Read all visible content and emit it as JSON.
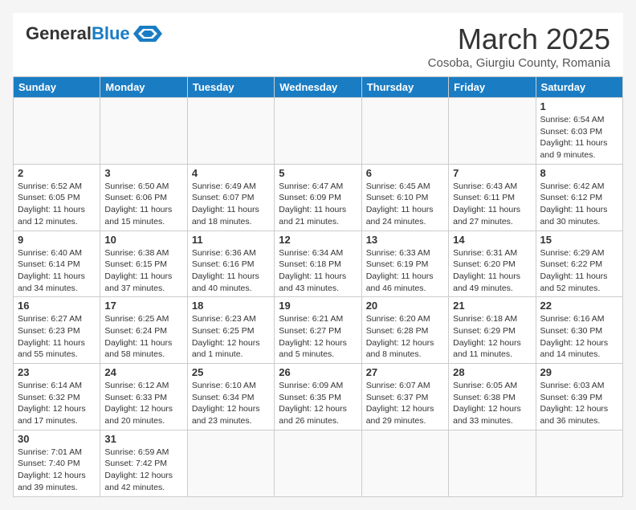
{
  "header": {
    "logo_general": "General",
    "logo_blue": "Blue",
    "month_title": "March 2025",
    "subtitle": "Cosoba, Giurgiu County, Romania"
  },
  "days_of_week": [
    "Sunday",
    "Monday",
    "Tuesday",
    "Wednesday",
    "Thursday",
    "Friday",
    "Saturday"
  ],
  "weeks": [
    [
      {
        "day": null,
        "info": ""
      },
      {
        "day": null,
        "info": ""
      },
      {
        "day": null,
        "info": ""
      },
      {
        "day": null,
        "info": ""
      },
      {
        "day": null,
        "info": ""
      },
      {
        "day": null,
        "info": ""
      },
      {
        "day": "1",
        "info": "Sunrise: 6:54 AM\nSunset: 6:03 PM\nDaylight: 11 hours\nand 9 minutes."
      }
    ],
    [
      {
        "day": "2",
        "info": "Sunrise: 6:52 AM\nSunset: 6:05 PM\nDaylight: 11 hours\nand 12 minutes."
      },
      {
        "day": "3",
        "info": "Sunrise: 6:50 AM\nSunset: 6:06 PM\nDaylight: 11 hours\nand 15 minutes."
      },
      {
        "day": "4",
        "info": "Sunrise: 6:49 AM\nSunset: 6:07 PM\nDaylight: 11 hours\nand 18 minutes."
      },
      {
        "day": "5",
        "info": "Sunrise: 6:47 AM\nSunset: 6:09 PM\nDaylight: 11 hours\nand 21 minutes."
      },
      {
        "day": "6",
        "info": "Sunrise: 6:45 AM\nSunset: 6:10 PM\nDaylight: 11 hours\nand 24 minutes."
      },
      {
        "day": "7",
        "info": "Sunrise: 6:43 AM\nSunset: 6:11 PM\nDaylight: 11 hours\nand 27 minutes."
      },
      {
        "day": "8",
        "info": "Sunrise: 6:42 AM\nSunset: 6:12 PM\nDaylight: 11 hours\nand 30 minutes."
      }
    ],
    [
      {
        "day": "9",
        "info": "Sunrise: 6:40 AM\nSunset: 6:14 PM\nDaylight: 11 hours\nand 34 minutes."
      },
      {
        "day": "10",
        "info": "Sunrise: 6:38 AM\nSunset: 6:15 PM\nDaylight: 11 hours\nand 37 minutes."
      },
      {
        "day": "11",
        "info": "Sunrise: 6:36 AM\nSunset: 6:16 PM\nDaylight: 11 hours\nand 40 minutes."
      },
      {
        "day": "12",
        "info": "Sunrise: 6:34 AM\nSunset: 6:18 PM\nDaylight: 11 hours\nand 43 minutes."
      },
      {
        "day": "13",
        "info": "Sunrise: 6:33 AM\nSunset: 6:19 PM\nDaylight: 11 hours\nand 46 minutes."
      },
      {
        "day": "14",
        "info": "Sunrise: 6:31 AM\nSunset: 6:20 PM\nDaylight: 11 hours\nand 49 minutes."
      },
      {
        "day": "15",
        "info": "Sunrise: 6:29 AM\nSunset: 6:22 PM\nDaylight: 11 hours\nand 52 minutes."
      }
    ],
    [
      {
        "day": "16",
        "info": "Sunrise: 6:27 AM\nSunset: 6:23 PM\nDaylight: 11 hours\nand 55 minutes."
      },
      {
        "day": "17",
        "info": "Sunrise: 6:25 AM\nSunset: 6:24 PM\nDaylight: 11 hours\nand 58 minutes."
      },
      {
        "day": "18",
        "info": "Sunrise: 6:23 AM\nSunset: 6:25 PM\nDaylight: 12 hours\nand 1 minute."
      },
      {
        "day": "19",
        "info": "Sunrise: 6:21 AM\nSunset: 6:27 PM\nDaylight: 12 hours\nand 5 minutes."
      },
      {
        "day": "20",
        "info": "Sunrise: 6:20 AM\nSunset: 6:28 PM\nDaylight: 12 hours\nand 8 minutes."
      },
      {
        "day": "21",
        "info": "Sunrise: 6:18 AM\nSunset: 6:29 PM\nDaylight: 12 hours\nand 11 minutes."
      },
      {
        "day": "22",
        "info": "Sunrise: 6:16 AM\nSunset: 6:30 PM\nDaylight: 12 hours\nand 14 minutes."
      }
    ],
    [
      {
        "day": "23",
        "info": "Sunrise: 6:14 AM\nSunset: 6:32 PM\nDaylight: 12 hours\nand 17 minutes."
      },
      {
        "day": "24",
        "info": "Sunrise: 6:12 AM\nSunset: 6:33 PM\nDaylight: 12 hours\nand 20 minutes."
      },
      {
        "day": "25",
        "info": "Sunrise: 6:10 AM\nSunset: 6:34 PM\nDaylight: 12 hours\nand 23 minutes."
      },
      {
        "day": "26",
        "info": "Sunrise: 6:09 AM\nSunset: 6:35 PM\nDaylight: 12 hours\nand 26 minutes."
      },
      {
        "day": "27",
        "info": "Sunrise: 6:07 AM\nSunset: 6:37 PM\nDaylight: 12 hours\nand 29 minutes."
      },
      {
        "day": "28",
        "info": "Sunrise: 6:05 AM\nSunset: 6:38 PM\nDaylight: 12 hours\nand 33 minutes."
      },
      {
        "day": "29",
        "info": "Sunrise: 6:03 AM\nSunset: 6:39 PM\nDaylight: 12 hours\nand 36 minutes."
      }
    ],
    [
      {
        "day": "30",
        "info": "Sunrise: 7:01 AM\nSunset: 7:40 PM\nDaylight: 12 hours\nand 39 minutes."
      },
      {
        "day": "31",
        "info": "Sunrise: 6:59 AM\nSunset: 7:42 PM\nDaylight: 12 hours\nand 42 minutes."
      },
      {
        "day": null,
        "info": ""
      },
      {
        "day": null,
        "info": ""
      },
      {
        "day": null,
        "info": ""
      },
      {
        "day": null,
        "info": ""
      },
      {
        "day": null,
        "info": ""
      }
    ]
  ]
}
